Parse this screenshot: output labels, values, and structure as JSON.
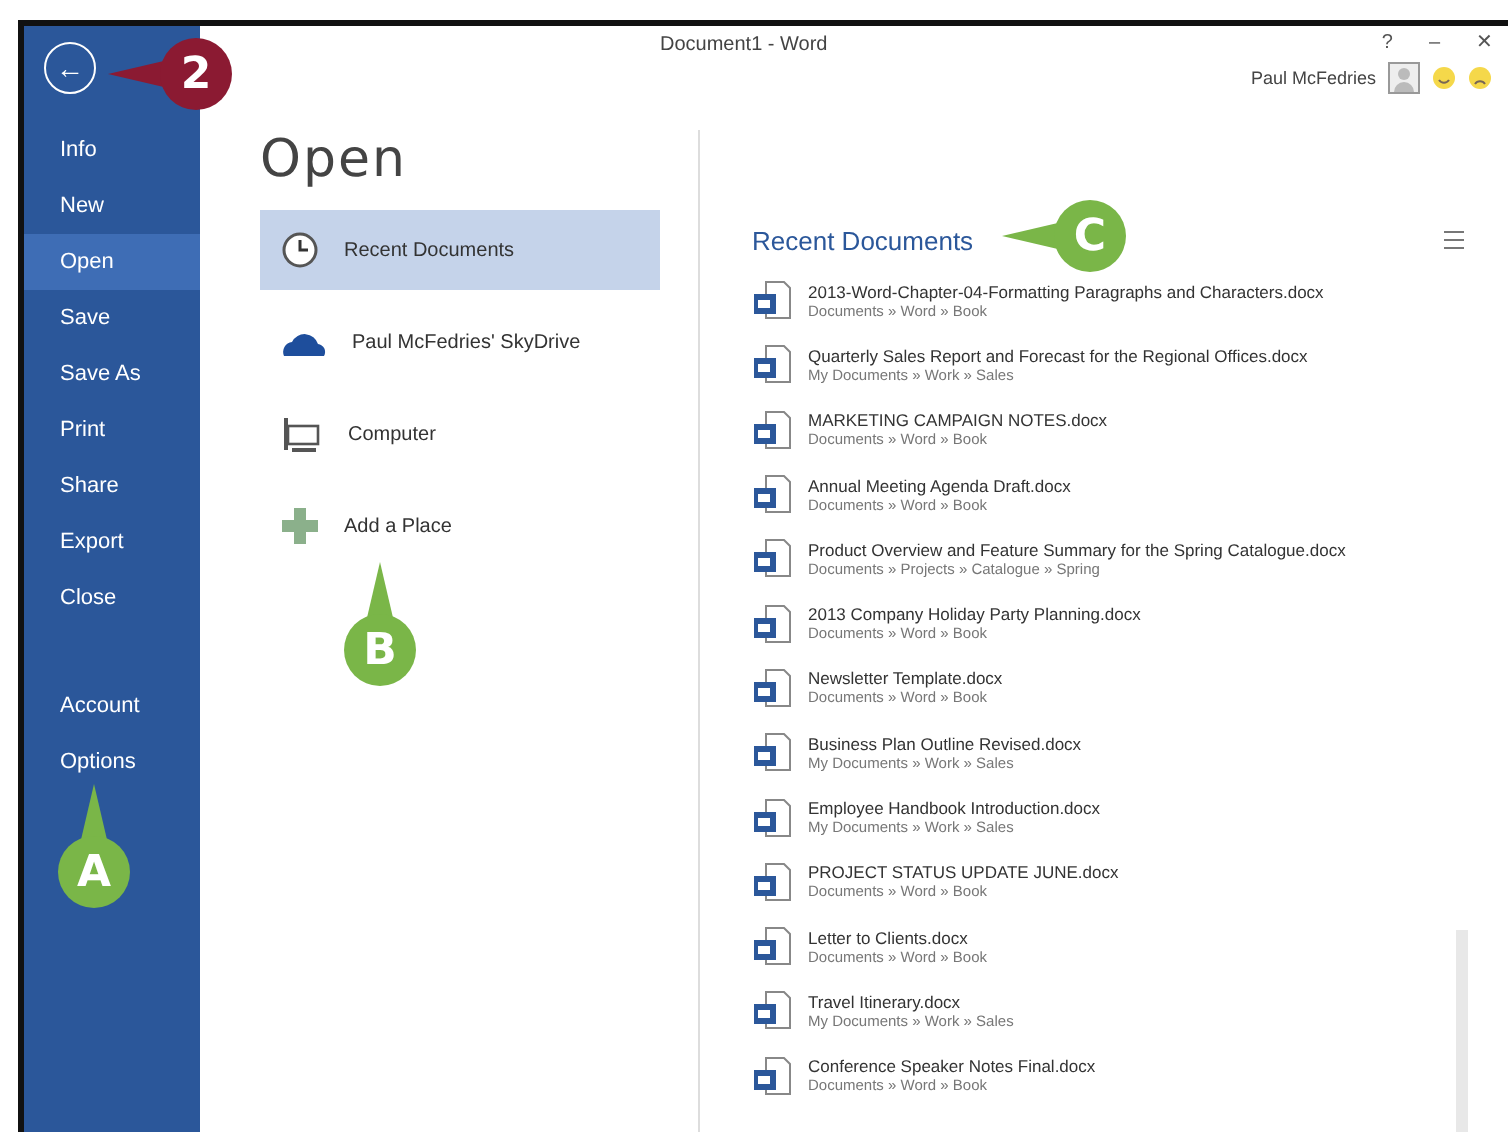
{
  "window": {
    "title": "Document1 - Word",
    "help": "?",
    "minimize": "–",
    "close": "✕",
    "user": "Paul McFedries"
  },
  "backstage": {
    "back": "←",
    "items": [
      {
        "label": "Info",
        "selected": false
      },
      {
        "label": "New",
        "selected": false
      },
      {
        "label": "Open",
        "selected": true
      },
      {
        "label": "Save",
        "selected": false
      },
      {
        "label": "Save As",
        "selected": false
      },
      {
        "label": "Print",
        "selected": false
      },
      {
        "label": "Share",
        "selected": false
      },
      {
        "label": "Export",
        "selected": false
      },
      {
        "label": "Close",
        "selected": false
      }
    ],
    "footer_items": [
      {
        "label": "Account",
        "selected": false
      },
      {
        "label": "Options",
        "selected": false
      }
    ]
  },
  "page_title": "Open",
  "places": [
    {
      "kind": "recent",
      "label": "Recent Documents",
      "selected": true
    },
    {
      "kind": "cloud",
      "label": "Paul McFedries' SkyDrive",
      "selected": false
    },
    {
      "kind": "computer",
      "label": "Computer",
      "selected": false
    },
    {
      "kind": "add",
      "label": "Add a Place",
      "selected": false
    }
  ],
  "recent": {
    "title": "Recent Documents",
    "documents": [
      {
        "name": "2013-Word-Chapter-04-Formatting Paragraphs and Characters.docx",
        "path": "Documents » Word » Book"
      },
      {
        "name": "Quarterly Sales Report and Forecast for the Regional Offices.docx",
        "path": "My Documents » Work » Sales"
      },
      {
        "name": "MARKETING CAMPAIGN NOTES.docx",
        "path": "Documents » Word » Book"
      },
      {
        "name": "Annual Meeting Agenda Draft.docx",
        "path": "Documents » Word » Book"
      },
      {
        "name": "Product Overview and Feature Summary for the Spring Catalogue.docx",
        "path": "Documents » Projects » Catalogue » Spring"
      },
      {
        "name": "2013 Company Holiday Party Planning.docx",
        "path": "Documents » Word » Book"
      },
      {
        "name": "Newsletter Template.docx",
        "path": "Documents » Word » Book"
      },
      {
        "name": "Business Plan Outline Revised.docx",
        "path": "My Documents » Work » Sales"
      },
      {
        "name": "Employee Handbook Introduction.docx",
        "path": "My Documents » Work » Sales"
      },
      {
        "name": "PROJECT STATUS UPDATE JUNE.docx",
        "path": "Documents » Word » Book"
      },
      {
        "name": "Letter to Clients.docx",
        "path": "Documents » Word » Book"
      },
      {
        "name": "Travel Itinerary.docx",
        "path": "My Documents » Work » Sales"
      },
      {
        "name": "Conference Speaker Notes Final.docx",
        "path": "Documents » Word » Book"
      }
    ]
  },
  "callouts": [
    {
      "kind": "step",
      "label": "2"
    },
    {
      "kind": "letter",
      "label": "A"
    },
    {
      "kind": "letter",
      "label": "B"
    },
    {
      "kind": "letter",
      "label": "C"
    }
  ]
}
